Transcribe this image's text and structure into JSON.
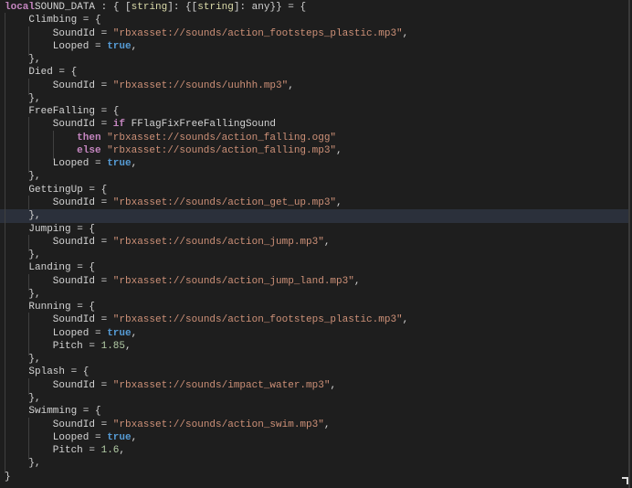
{
  "editor": {
    "highlighted_line": 17,
    "colors": {
      "background": "#1e1e1e",
      "keyword": "#c586c0",
      "string": "#ce9178",
      "boolean": "#569cd6",
      "type": "#dcdcaa",
      "number": "#b5cea8"
    },
    "lines": [
      [
        [
          "kw",
          "local"
        ],
        [
          "",
          "SOUND_DATA : { ["
        ],
        [
          "type",
          "string"
        ],
        [
          "",
          "]: {["
        ],
        [
          "type",
          "string"
        ],
        [
          "",
          "]: any}} = {"
        ]
      ],
      [
        [
          "",
          "    Climbing = {"
        ]
      ],
      [
        [
          "",
          "        SoundId = "
        ],
        [
          "str",
          "\"rbxasset://sounds/action_footsteps_plastic.mp3\""
        ],
        [
          "",
          ","
        ]
      ],
      [
        [
          "",
          "        Looped = "
        ],
        [
          "bool",
          "true"
        ],
        [
          "",
          ","
        ]
      ],
      [
        [
          "",
          "    },"
        ]
      ],
      [
        [
          "",
          "    Died = {"
        ]
      ],
      [
        [
          "",
          "        SoundId = "
        ],
        [
          "str",
          "\"rbxasset://sounds/uuhhh.mp3\""
        ],
        [
          "",
          ","
        ]
      ],
      [
        [
          "",
          "    },"
        ]
      ],
      [
        [
          "",
          "    FreeFalling = {"
        ]
      ],
      [
        [
          "",
          "        SoundId = "
        ],
        [
          "kw",
          "if"
        ],
        [
          "",
          "",
          " FFlagFixFreeFallingSound"
        ]
      ],
      [
        [
          "",
          "            "
        ],
        [
          "kw",
          "then"
        ],
        [
          "str",
          " \"rbxasset://sounds/action_falling.ogg\""
        ]
      ],
      [
        [
          "",
          "            "
        ],
        [
          "kw",
          "else"
        ],
        [
          "str",
          " \"rbxasset://sounds/action_falling.mp3\""
        ],
        [
          "",
          ","
        ]
      ],
      [
        [
          "",
          "        Looped = "
        ],
        [
          "bool",
          "true"
        ],
        [
          "",
          ","
        ]
      ],
      [
        [
          "",
          "    },"
        ]
      ],
      [
        [
          "",
          "    GettingUp = {"
        ]
      ],
      [
        [
          "",
          "        SoundId = "
        ],
        [
          "str",
          "\"rbxasset://sounds/action_get_up.mp3\""
        ],
        [
          "",
          ","
        ]
      ],
      [
        [
          "",
          "    },"
        ]
      ],
      [
        [
          "",
          "    Jumping = {"
        ]
      ],
      [
        [
          "",
          "        SoundId = "
        ],
        [
          "str",
          "\"rbxasset://sounds/action_jump.mp3\""
        ],
        [
          "",
          ","
        ]
      ],
      [
        [
          "",
          "    },"
        ]
      ],
      [
        [
          "",
          "    Landing = {"
        ]
      ],
      [
        [
          "",
          "        SoundId = "
        ],
        [
          "str",
          "\"rbxasset://sounds/action_jump_land.mp3\""
        ],
        [
          "",
          ","
        ]
      ],
      [
        [
          "",
          "    },"
        ]
      ],
      [
        [
          "",
          "    Running = {"
        ]
      ],
      [
        [
          "",
          "        SoundId = "
        ],
        [
          "str",
          "\"rbxasset://sounds/action_footsteps_plastic.mp3\""
        ],
        [
          "",
          ","
        ]
      ],
      [
        [
          "",
          "        Looped = "
        ],
        [
          "bool",
          "true"
        ],
        [
          "",
          ","
        ]
      ],
      [
        [
          "",
          "        Pitch = "
        ],
        [
          "num",
          "1.85"
        ],
        [
          "",
          ","
        ]
      ],
      [
        [
          "",
          "    },"
        ]
      ],
      [
        [
          "",
          "    Splash = {"
        ]
      ],
      [
        [
          "",
          "        SoundId = "
        ],
        [
          "str",
          "\"rbxasset://sounds/impact_water.mp3\""
        ],
        [
          "",
          ","
        ]
      ],
      [
        [
          "",
          "    },"
        ]
      ],
      [
        [
          "",
          "    Swimming = {"
        ]
      ],
      [
        [
          "",
          "        SoundId = "
        ],
        [
          "str",
          "\"rbxasset://sounds/action_swim.mp3\""
        ],
        [
          "",
          ","
        ]
      ],
      [
        [
          "",
          "        Looped = "
        ],
        [
          "bool",
          "true"
        ],
        [
          "",
          ","
        ]
      ],
      [
        [
          "",
          "        Pitch = "
        ],
        [
          "num",
          "1.6"
        ],
        [
          "",
          ","
        ]
      ],
      [
        [
          "",
          "    },"
        ]
      ],
      [
        [
          "",
          "}"
        ]
      ]
    ]
  }
}
